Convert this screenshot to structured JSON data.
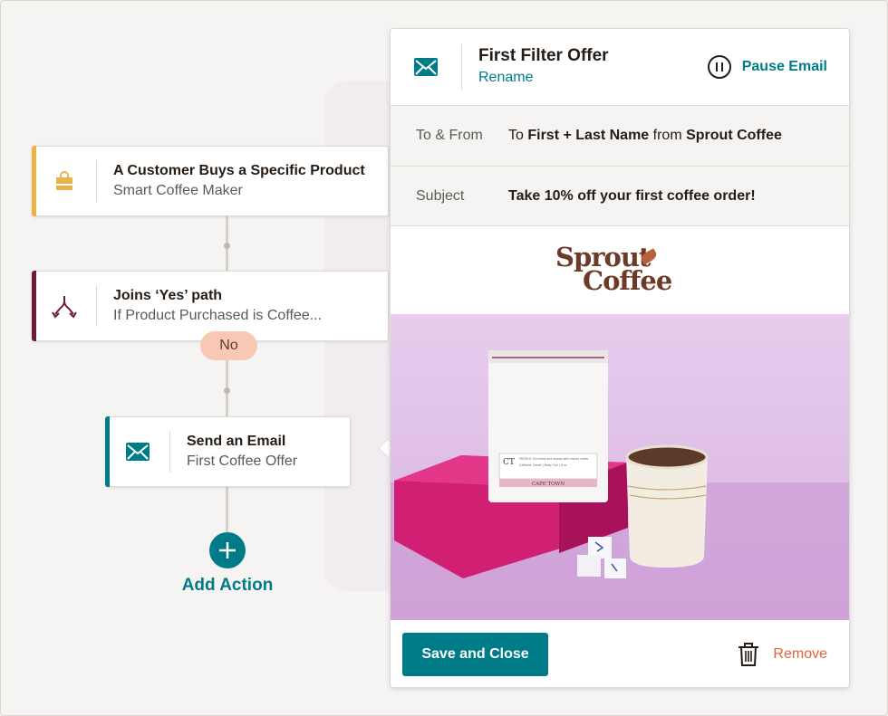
{
  "workflow": {
    "trigger": {
      "title": "A Customer Buys a Specific Product",
      "subtitle": "Smart Coffee Maker",
      "icon": "shopping-bag-icon",
      "accent": "#e8b34a"
    },
    "branch": {
      "title": "Joins ‘Yes’ path",
      "subtitle": "If Product Purchased is Coffee...",
      "icon": "split-path-icon",
      "accent": "#6e1a3d"
    },
    "no_pill": "No",
    "email_step": {
      "title": "Send an Email",
      "subtitle": "First Coffee Offer",
      "icon": "envelope-icon",
      "accent": "#007c89"
    },
    "add_action": "Add Action"
  },
  "panel": {
    "title": "First Filter Offer",
    "rename": "Rename",
    "pause_label": "Pause Email",
    "to_from": {
      "label": "To & From",
      "prefix": "To",
      "recipient": "First + Last Name",
      "middle": "from",
      "sender": "Sprout Coffee"
    },
    "subject": {
      "label": "Subject",
      "value": "Take 10% off your first coffee order!"
    },
    "logo": {
      "line1": "Sprout",
      "line2": "Coffee"
    },
    "photo": {
      "bag_monogram": "CT",
      "bag_profile": "PROFILE: Enriched and woody with honey notes",
      "bag_details": "Caffeine: Decaf | Body: Full | 8 oz",
      "bag_name": "CAPE TOWN"
    },
    "save_label": "Save and Close",
    "remove_label": "Remove"
  },
  "colors": {
    "primary": "#007c89",
    "remove": "#e2633a",
    "pill": "#f9c8b4"
  }
}
